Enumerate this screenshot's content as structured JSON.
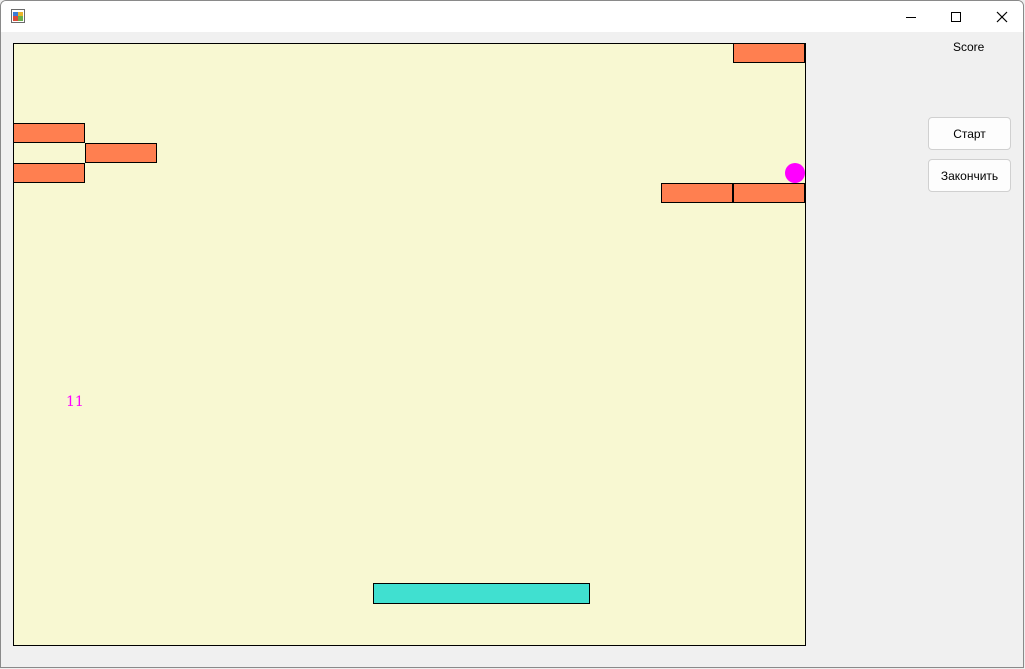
{
  "window": {
    "title": "",
    "controls": {
      "minimize": "minimize-icon",
      "maximize": "maximize-icon",
      "close": "close-icon"
    }
  },
  "game": {
    "lives_display": "11",
    "colors": {
      "field": "#f8f8d2",
      "brick": "#ff7f50",
      "ball": "#ff00ff",
      "paddle": "#40e0d0"
    }
  },
  "side_panel": {
    "score_label": "Score",
    "start_button": "Старт",
    "finish_button": "Закончить"
  }
}
